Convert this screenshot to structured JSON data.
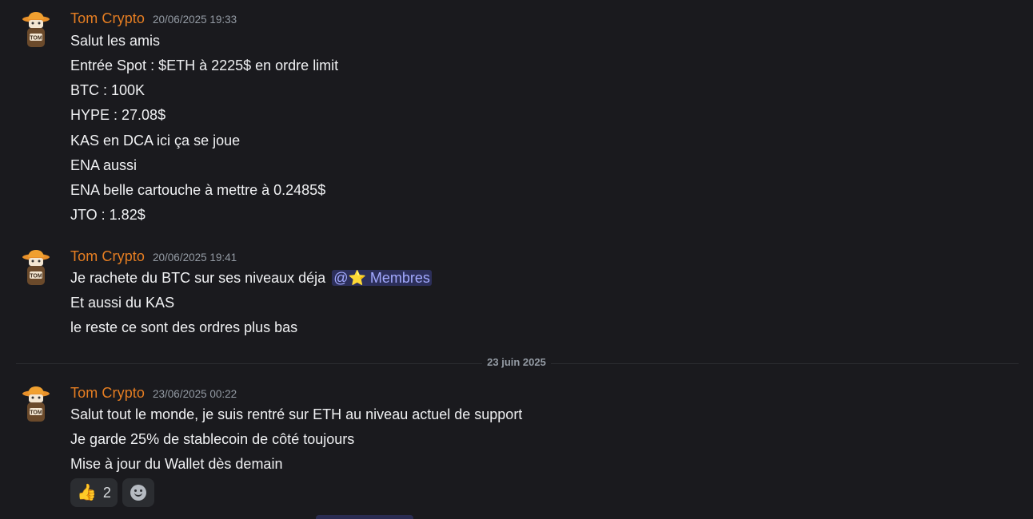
{
  "messages": [
    {
      "author": "Tom Crypto",
      "timestamp": "20/06/2025 19:33",
      "lines": [
        "Salut les amis",
        "Entrée Spot : $ETH à 2225$ en ordre limit",
        "BTC : 100K",
        "HYPE : 27.08$",
        "KAS en DCA ici ça se joue",
        "ENA aussi",
        "ENA belle cartouche à mettre à 0.2485$",
        "JTO : 1.82$"
      ]
    },
    {
      "author": "Tom Crypto",
      "timestamp": "20/06/2025 19:41",
      "line1_text": "Je rachete du BTC sur ses niveaux déja",
      "mention": "@⭐ Membres",
      "lines": [
        "Et aussi du KAS",
        "le reste ce sont des ordres plus bas"
      ]
    },
    {
      "author": "Tom Crypto",
      "timestamp": "23/06/2025 00:22",
      "lines": [
        "Salut tout le monde, je suis rentré sur ETH au niveau actuel de support",
        "Je garde 25% de stablecoin de côté toujours",
        "Mise à jour du Wallet dès demain"
      ],
      "reactions": [
        {
          "emoji": "👍",
          "count": "2"
        }
      ]
    }
  ],
  "date_divider": "23 juin 2025",
  "avatar_text": "TOM",
  "colors": {
    "author": "#e67e22",
    "mention_bg": "#2c2f5a",
    "mention_fg": "#a3aaff",
    "background": "#1a1a1e"
  }
}
